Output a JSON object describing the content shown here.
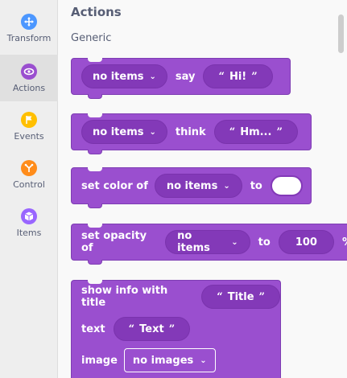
{
  "sidebar": {
    "items": [
      {
        "label": "Transform",
        "color": "#4c97ff"
      },
      {
        "label": "Actions",
        "color": "#9a4fcf"
      },
      {
        "label": "Events",
        "color": "#ffbf00"
      },
      {
        "label": "Control",
        "color": "#ff8c1a"
      },
      {
        "label": "Items",
        "color": "#9966ff"
      }
    ],
    "active": "Actions"
  },
  "main": {
    "section_title": "Actions",
    "sub_title": "Generic",
    "blocks": {
      "say": {
        "target": "no items",
        "verb": "say",
        "quote_open": "“",
        "text": "Hi!",
        "quote_close": "”"
      },
      "think": {
        "target": "no items",
        "verb": "think",
        "quote_open": "“",
        "text": "Hm...",
        "quote_close": "”"
      },
      "set_color": {
        "label": "set color of",
        "target": "no items",
        "to": "to"
      },
      "set_opacity": {
        "label": "set opacity of",
        "target": "no items",
        "to": "to",
        "value": "100",
        "unit": "%"
      },
      "show_info": {
        "label": "show info with title",
        "quote_open": "“",
        "title": "Title",
        "quote_close": "”",
        "text_label": "text",
        "text_value": "Text",
        "image_label": "image",
        "image_value": "no images"
      }
    }
  },
  "colors": {
    "block": "#9a4fcf",
    "block_dark": "#8339b8",
    "accent": "#575e75"
  }
}
